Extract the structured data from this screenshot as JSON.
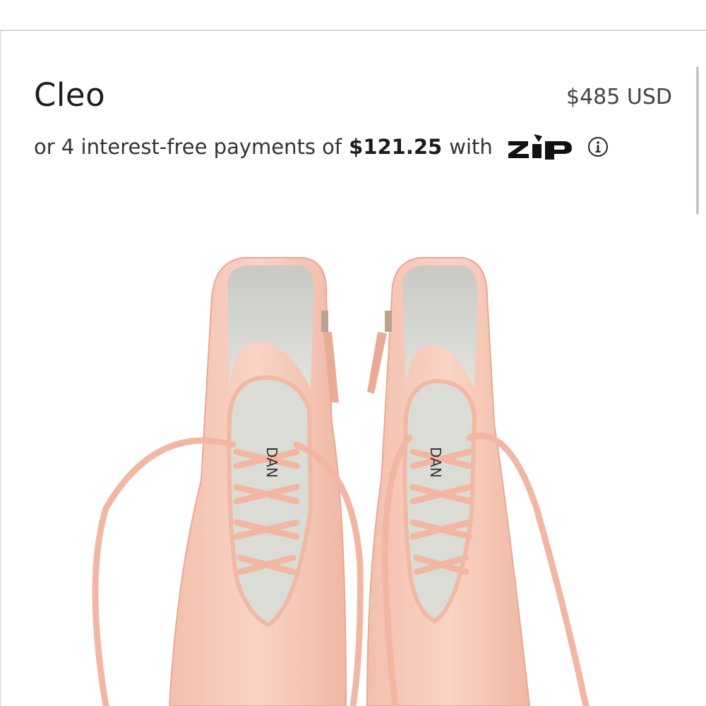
{
  "product": {
    "title": "Cleo",
    "price": "$485 USD"
  },
  "financing": {
    "prefix": "or 4 interest-free payments of",
    "installment_amount": "$121.25",
    "suffix": "with",
    "provider_logo_text": "zip",
    "info_icon": "info-circle-icon"
  },
  "image": {
    "subject": "pink lace-up ankle boots",
    "insole_brand_text": "DANIELLA"
  },
  "colors": {
    "background": "#ffffff",
    "leather": "#f6c7b6",
    "lining": "#d3d3cf"
  }
}
